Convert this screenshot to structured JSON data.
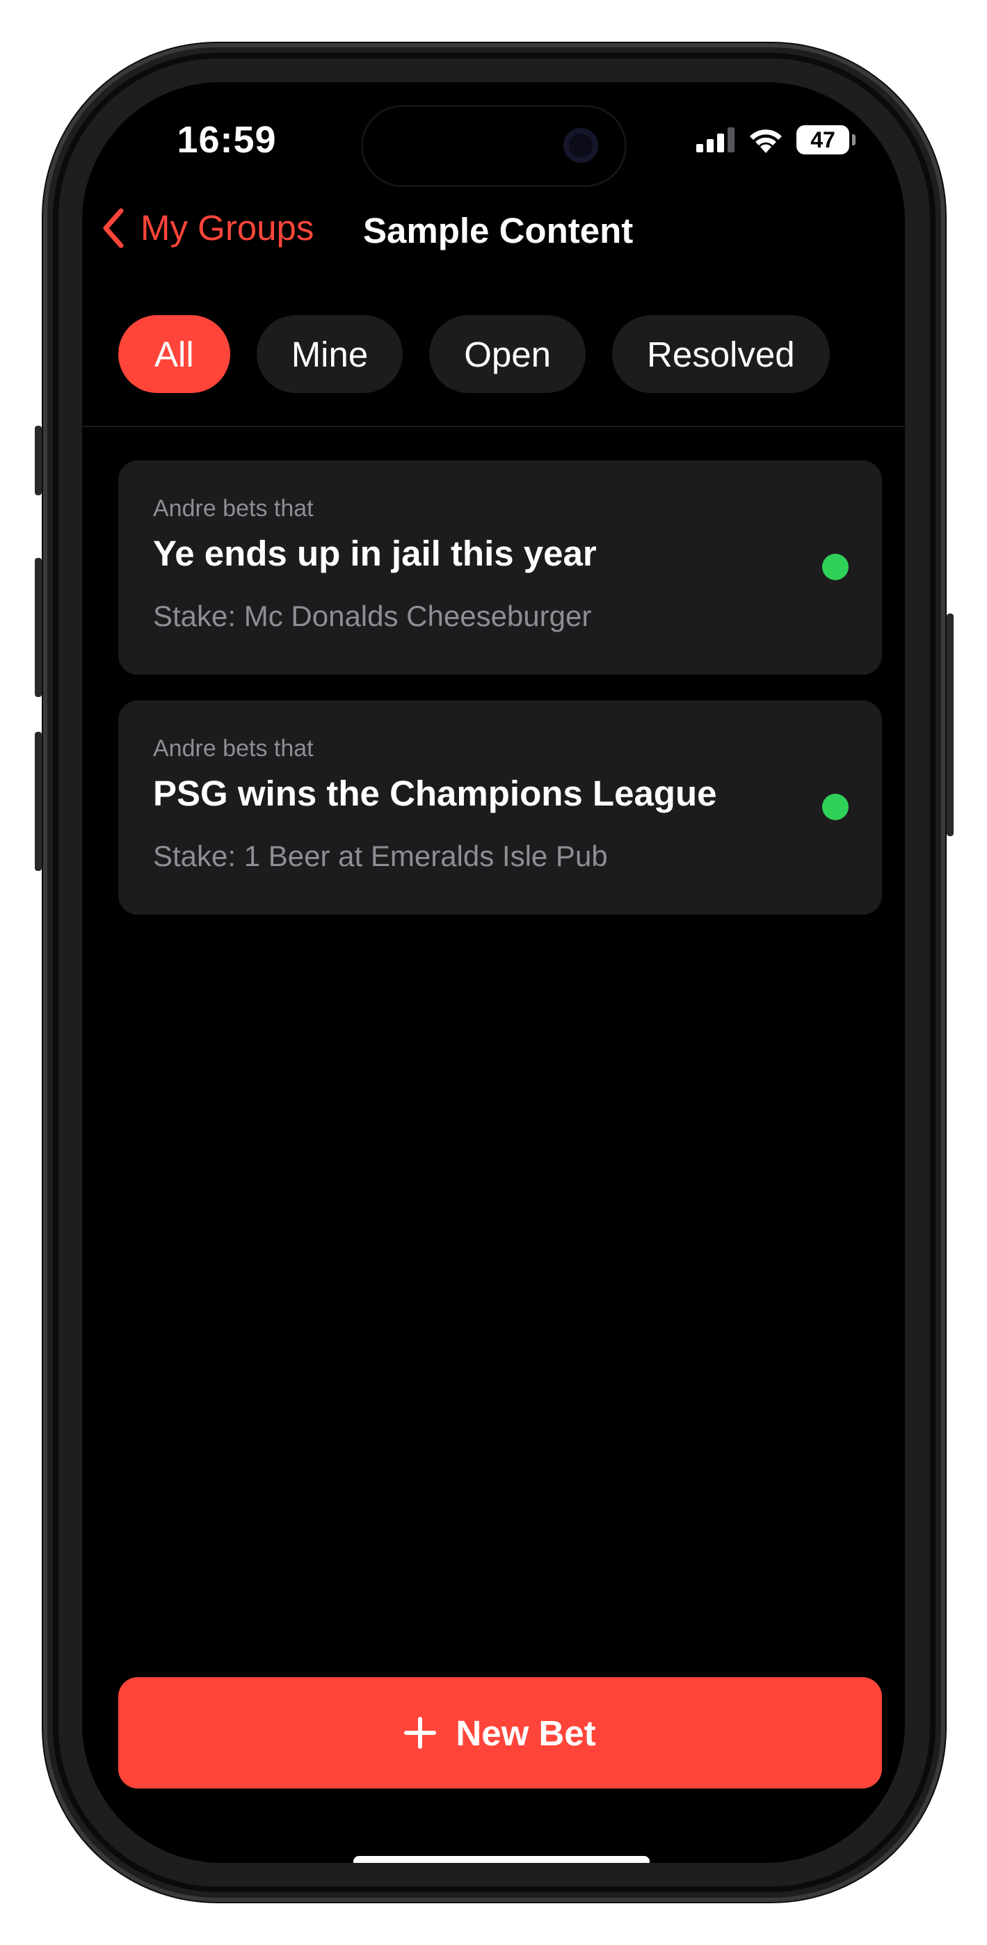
{
  "status_bar": {
    "time": "16:59",
    "battery_level": "47",
    "icons": [
      "cellular-signal-icon",
      "wifi-icon",
      "battery-icon"
    ]
  },
  "nav": {
    "back_label": "My Groups",
    "title": "Sample Content",
    "accent_color": "#ff453a"
  },
  "filters": {
    "selected": "All",
    "tabs": [
      {
        "label": "All"
      },
      {
        "label": "Mine"
      },
      {
        "label": "Open"
      },
      {
        "label": "Resolved"
      }
    ]
  },
  "bets": [
    {
      "kicker": "Andre bets that",
      "title": "Ye ends up in jail this year",
      "stake": "Stake: Mc Donalds Cheeseburger",
      "status_color": "#30d158"
    },
    {
      "kicker": "Andre bets that",
      "title": "PSG wins the Champions League",
      "stake": "Stake: 1 Beer at Emeralds Isle Pub",
      "status_color": "#30d158"
    }
  ],
  "actions": {
    "new_bet_label": "New Bet"
  }
}
